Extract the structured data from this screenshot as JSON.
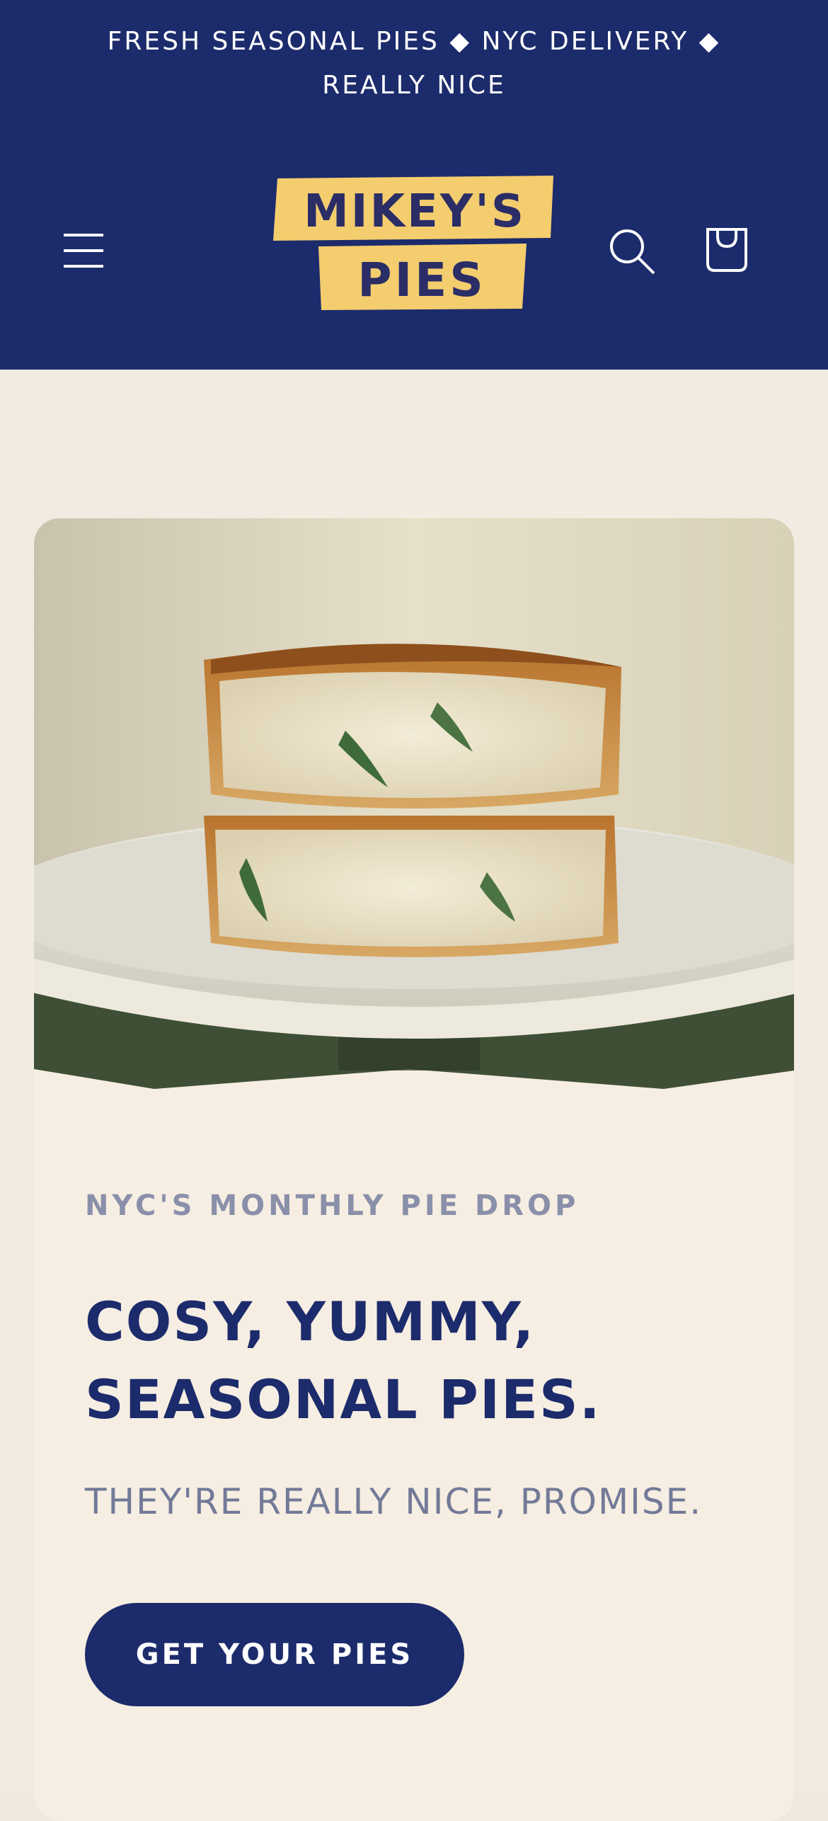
{
  "announcement": {
    "text": "Fresh Seasonal Pies ◆ NYC Delivery ◆ Really Nice"
  },
  "header": {
    "logo_line1": "MIKEY'S",
    "logo_line2": "PIES",
    "menu_icon": "hamburger-menu-icon",
    "search_icon": "search-icon",
    "cart_icon": "shopping-bag-icon"
  },
  "hero": {
    "eyebrow": "NYC'S MONTHLY PIE DROP",
    "headline": "Cosy, Yummy, Seasonal Pies.",
    "subhead": "THEY'RE REALLY NICE, PROMISE.",
    "cta_label": "GET YOUR PIES"
  },
  "colors": {
    "brand_navy": "#1c2b6b",
    "logo_yellow": "#f4cd6e",
    "card_bg": "#f6eee2",
    "page_bg": "#f1ebe1",
    "muted_text": "#8a90aa"
  }
}
